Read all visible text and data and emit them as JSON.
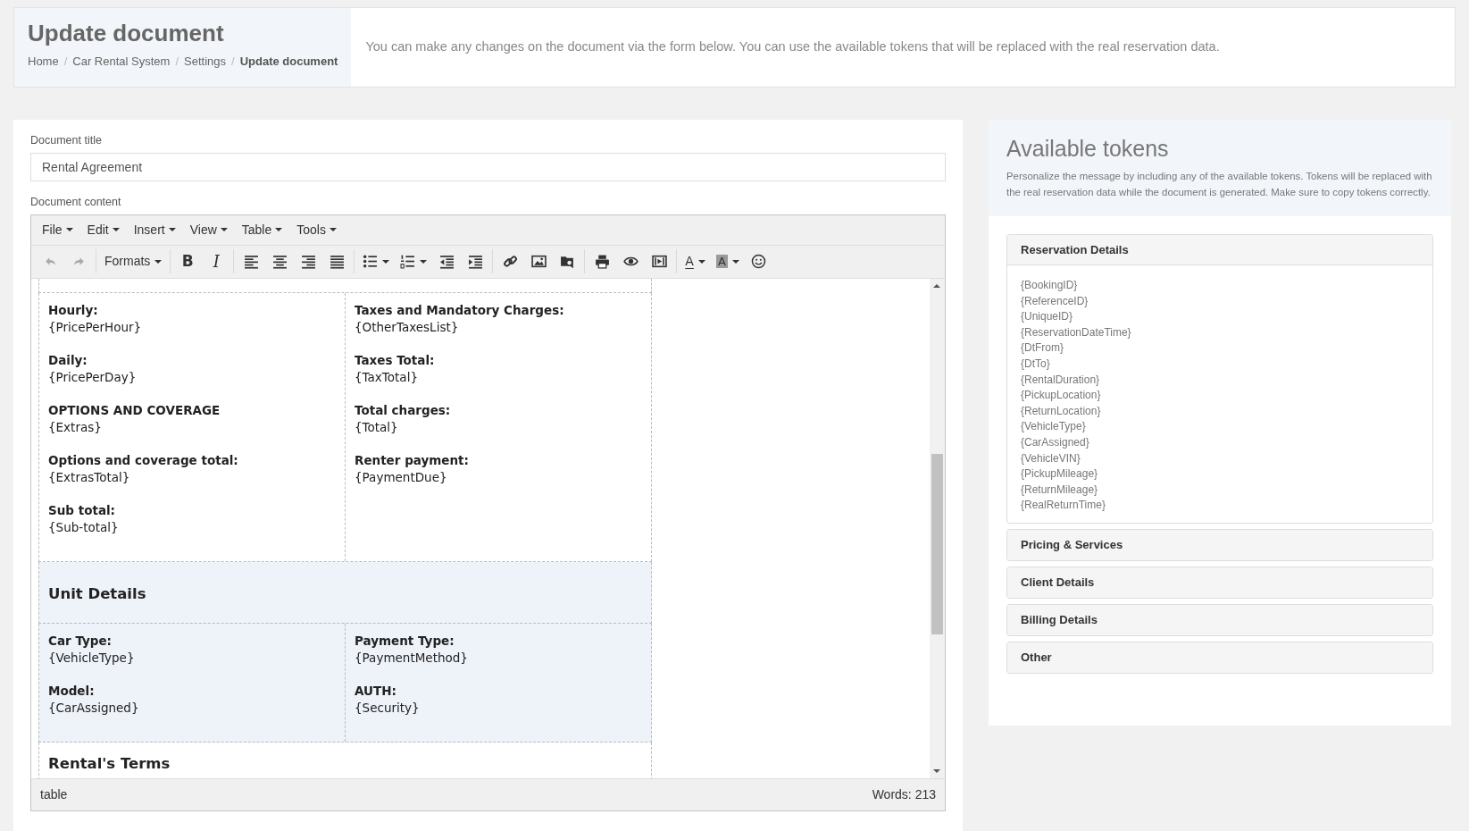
{
  "header": {
    "title": "Update document",
    "breadcrumb_separator": "/",
    "breadcrumbs": [
      {
        "label": "Home",
        "selected": false
      },
      {
        "label": "Car Rental System",
        "selected": false
      },
      {
        "label": "Settings",
        "selected": false
      },
      {
        "label": "Update document",
        "selected": true
      }
    ],
    "description": "You can make any changes on the document via the form below. You can use the available tokens that will be replaced with the real reservation data."
  },
  "form": {
    "title_label": "Document title",
    "title_value": "Rental Agreement",
    "content_label": "Document content"
  },
  "editor": {
    "menus": [
      "File",
      "Edit",
      "Insert",
      "View",
      "Table",
      "Tools"
    ],
    "toolbar": [
      [
        {
          "kind": "undo",
          "disabled": true,
          "dropdown": false
        },
        {
          "kind": "redo",
          "disabled": true,
          "dropdown": false
        }
      ],
      [
        {
          "kind": "formats",
          "label": "Formats",
          "disabled": false,
          "dropdown": true
        }
      ],
      [
        {
          "kind": "bold",
          "label": "B",
          "disabled": false,
          "dropdown": false
        },
        {
          "kind": "italic",
          "label": "I",
          "disabled": false,
          "dropdown": false
        }
      ],
      [
        {
          "kind": "align-left",
          "disabled": false,
          "dropdown": false
        },
        {
          "kind": "align-center",
          "disabled": false,
          "dropdown": false
        },
        {
          "kind": "align-right",
          "disabled": false,
          "dropdown": false
        },
        {
          "kind": "justify",
          "disabled": false,
          "dropdown": false
        }
      ],
      [
        {
          "kind": "bullet-list",
          "disabled": false,
          "dropdown": true
        },
        {
          "kind": "numbered-list",
          "disabled": false,
          "dropdown": true
        },
        {
          "kind": "outdent",
          "disabled": false,
          "dropdown": false
        },
        {
          "kind": "indent",
          "disabled": false,
          "dropdown": false
        }
      ],
      [
        {
          "kind": "link",
          "disabled": false,
          "dropdown": false
        },
        {
          "kind": "image",
          "disabled": false,
          "dropdown": false
        },
        {
          "kind": "browse",
          "disabled": false,
          "dropdown": false
        }
      ],
      [
        {
          "kind": "print",
          "disabled": false,
          "dropdown": false
        },
        {
          "kind": "preview",
          "disabled": false,
          "dropdown": false
        },
        {
          "kind": "media",
          "disabled": false,
          "dropdown": false
        }
      ],
      [
        {
          "kind": "text-color",
          "label": "A",
          "disabled": false,
          "dropdown": true
        },
        {
          "kind": "background-color",
          "label": "A",
          "disabled": false,
          "dropdown": true
        },
        {
          "kind": "emoji",
          "disabled": false,
          "dropdown": false
        }
      ]
    ],
    "document": [
      {
        "kind": "fields",
        "shaded": false,
        "columns": [
          [
            {
              "label": "Hourly:",
              "token": "{PricePerHour}"
            },
            {
              "label": "Daily:",
              "token": "{PricePerDay}"
            },
            {
              "label": "OPTIONS AND COVERAGE",
              "token": "{Extras}"
            },
            {
              "label": "Options and coverage total:",
              "token": "{ExtrasTotal}"
            },
            {
              "label": "Sub total:",
              "token": "{Sub-total}"
            }
          ],
          [
            {
              "label": "Taxes and Mandatory Charges:",
              "token": "{OtherTaxesList}"
            },
            {
              "label": "Taxes Total:",
              "token": "{TaxTotal}"
            },
            {
              "label": "Total charges:",
              "token": "{Total}"
            },
            {
              "label": "Renter payment:",
              "token": "{PaymentDue}"
            }
          ]
        ]
      },
      {
        "kind": "heading",
        "shaded": true,
        "text": "Unit Details"
      },
      {
        "kind": "fields",
        "shaded": true,
        "columns": [
          [
            {
              "label": "Car Type:",
              "token": "{VehicleType}"
            },
            {
              "label": "Model:",
              "token": "{CarAssigned}"
            }
          ],
          [
            {
              "label": "Payment Type:",
              "token": "{PaymentMethod}"
            },
            {
              "label": "AUTH:",
              "token": "{Security}"
            }
          ]
        ]
      },
      {
        "kind": "heading",
        "shaded": false,
        "text": "Rental's Terms"
      }
    ],
    "status_path": "table",
    "word_count": "Words: 213"
  },
  "tokens_panel": {
    "title": "Available tokens",
    "description": "Personalize the message by including any of the available tokens. Tokens will be replaced with the real reservation data while the document is generated. Make sure to copy tokens correctly.",
    "groups": [
      {
        "title": "Reservation Details",
        "expanded": true,
        "tokens": [
          "{BookingID}",
          "{ReferenceID}",
          "{UniqueID}",
          "{ReservationDateTime}",
          "{DtFrom}",
          "{DtTo}",
          "{RentalDuration}",
          "{PickupLocation}",
          "{ReturnLocation}",
          "{VehicleType}",
          "{CarAssigned}",
          "{VehicleVIN}",
          "{PickupMileage}",
          "{ReturnMileage}",
          "{RealReturnTime}"
        ]
      },
      {
        "title": "Pricing & Services",
        "expanded": false
      },
      {
        "title": "Client Details",
        "expanded": false
      },
      {
        "title": "Billing Details",
        "expanded": false
      },
      {
        "title": "Other",
        "expanded": false
      }
    ]
  }
}
